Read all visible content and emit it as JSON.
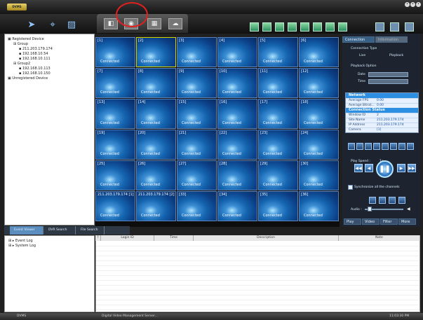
{
  "app": {
    "logo_text": "DVMS"
  },
  "window_controls": [
    "minimize",
    "restore",
    "close"
  ],
  "toolbar": {
    "icons": [
      "arrow-icon",
      "pin-icon",
      "image-icon"
    ],
    "mode_tabs": [
      "camera-icon",
      "live-view-icon",
      "grid-icon",
      "cloud-icon"
    ],
    "layout_buttons": [
      "layout-1",
      "layout-4",
      "layout-9",
      "layout-16",
      "layout-25",
      "layout-36",
      "layout-49",
      "layout-64"
    ]
  },
  "tree": {
    "items": [
      {
        "label": "Registered Device",
        "indent": 0
      },
      {
        "label": "Group",
        "indent": 1
      },
      {
        "label": "211.203.179.174",
        "indent": 2
      },
      {
        "label": "192.168.10.54",
        "indent": 2
      },
      {
        "label": "192.168.10.111",
        "indent": 2
      },
      {
        "label": "Group2",
        "indent": 1
      },
      {
        "label": "192.168.10.113",
        "indent": 2
      },
      {
        "label": "192.168.10.150",
        "indent": 2
      },
      {
        "label": "Unregistered Device",
        "indent": 0
      }
    ]
  },
  "grid": {
    "cells": [
      "[1]",
      "[2]",
      "[3]",
      "[4]",
      "[5]",
      "[6]",
      "[7]",
      "[8]",
      "[9]",
      "[10]",
      "[11]",
      "[12]",
      "[13]",
      "[14]",
      "[15]",
      "[16]",
      "[17]",
      "[18]",
      "[19]",
      "[20]",
      "[21]",
      "[22]",
      "[23]",
      "[24]",
      "[25]",
      "[26]",
      "[27]",
      "[28]",
      "[29]",
      "[30]",
      "211.203.179.174 [1]",
      "211.203.179.174 [2]",
      "[33]",
      "[34]",
      "[35]",
      "[36]"
    ],
    "status": "Connected"
  },
  "right_panel": {
    "tabs": [
      "Connection",
      "Information"
    ],
    "connection_type_label": "Connection Type",
    "live_label": "Live",
    "playback_label": "Playback",
    "playback_option_label": "Playback Option",
    "date_label": "Date",
    "time_label": "Time",
    "status_sections": [
      {
        "title": "Network",
        "rows": [
          [
            "Average FPS",
            "0.00"
          ],
          [
            "Average Bitrat...",
            "0.00"
          ]
        ]
      },
      {
        "title": "Connection Status",
        "rows": [
          [
            "Window ID",
            "2"
          ],
          [
            "Site Name",
            "211.203.179.174"
          ],
          [
            "IP Address",
            "211.203.179.174"
          ],
          [
            "Camera",
            "[1]"
          ]
        ]
      }
    ],
    "play_speed_label": "Play Speed :",
    "play_speed_value": "1x",
    "sync_label": "Synchronize all the channels",
    "audio_label": "Audio :",
    "audio_level": 0.08,
    "bottom_tabs": [
      "Play",
      "Video",
      "Filter",
      "More"
    ]
  },
  "lower_tabs": [
    "Event Viewer",
    "DVR Search",
    "File Search"
  ],
  "log_tree": [
    {
      "label": "Event Log",
      "indent": 0
    },
    {
      "label": "System Log",
      "indent": 0
    }
  ],
  "log_table": {
    "headers": [
      "?",
      "Login ID",
      "Time",
      "Description",
      "Note"
    ],
    "rows": 14
  },
  "statusbar": {
    "app_name": "DVMS",
    "server_text": "Digital Video Management Server...",
    "clock": "11:03:30 PM"
  },
  "colors": {
    "highlight": "#e32020",
    "panel_blue": "#2d8fe1",
    "camera_blue": "#1565b0"
  }
}
